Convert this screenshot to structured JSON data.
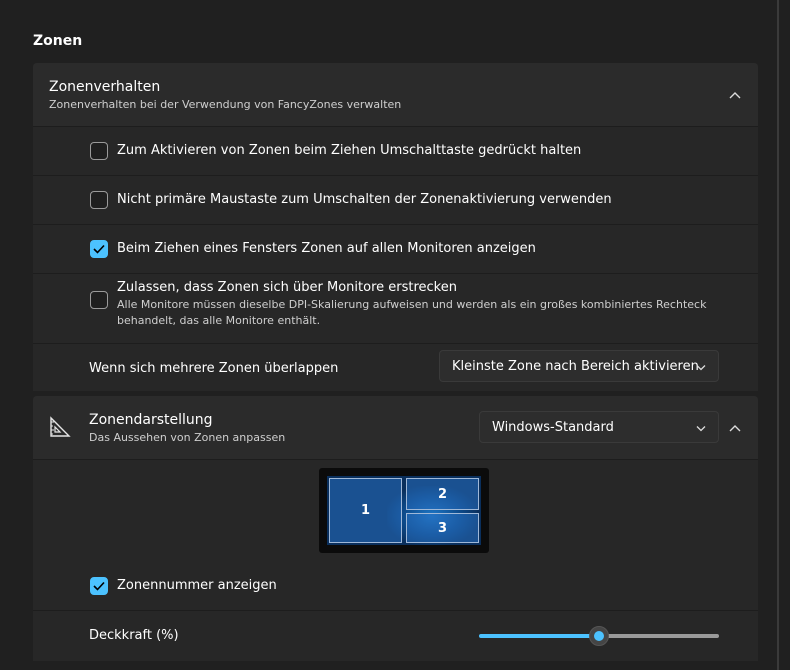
{
  "section_title": "Zonen",
  "zone_behavior": {
    "title": "Zonenverhalten",
    "subtitle": "Zonenverhalten bei der Verwendung von FancyZones verwalten",
    "options": [
      {
        "label": "Zum Aktivieren von Zonen beim Ziehen Umschalttaste gedrückt halten",
        "checked": false
      },
      {
        "label": "Nicht primäre Maustaste zum Umschalten der Zonenaktivierung verwenden",
        "checked": false
      },
      {
        "label": "Beim Ziehen eines Fensters Zonen auf allen Monitoren anzeigen",
        "checked": true
      },
      {
        "label": "Zulassen, dass Zonen sich über Monitore erstrecken",
        "checked": false,
        "description": "Alle Monitore müssen dieselbe DPI-Skalierung aufweisen und werden als ein großes kombiniertes Rechteck behandelt, das alle Monitore enthält."
      }
    ],
    "overlap": {
      "label": "Wenn sich mehrere Zonen überlappen",
      "selected": "Kleinste Zone nach Bereich aktivieren"
    }
  },
  "zone_appearance": {
    "title": "Zonendarstellung",
    "subtitle": "Das Aussehen von Zonen anpassen",
    "selected": "Windows-Standard",
    "zones": [
      "1",
      "2",
      "3"
    ],
    "show_number": {
      "label": "Zonennummer anzeigen",
      "checked": true
    },
    "opacity": {
      "label": "Deckkraft (%)",
      "value_fraction": 0.5
    }
  },
  "colors": {
    "accent": "#4cc2ff",
    "background": "#202020",
    "card": "#2b2b2b"
  }
}
